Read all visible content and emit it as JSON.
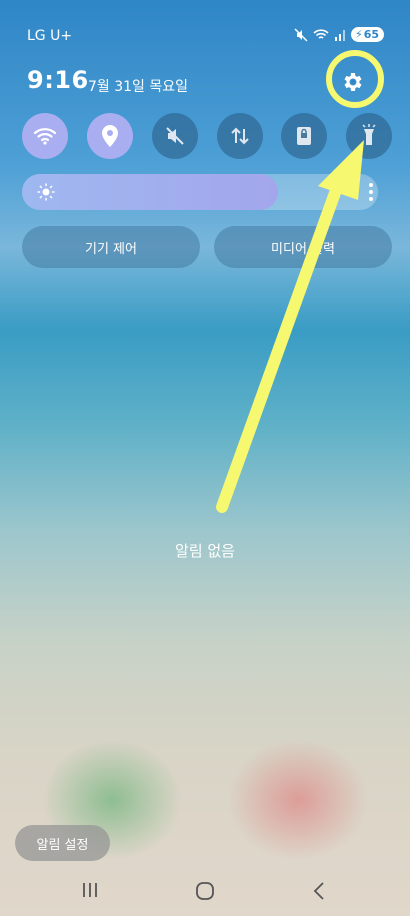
{
  "status": {
    "carrier": "LG U+",
    "battery": "65"
  },
  "header": {
    "time": "9:16",
    "date": "7월 31일 목요일"
  },
  "quick_tiles": [
    {
      "name": "wifi-icon",
      "active": true
    },
    {
      "name": "location-icon",
      "active": true
    },
    {
      "name": "mute-icon",
      "active": false
    },
    {
      "name": "mobile-data-icon",
      "active": false
    },
    {
      "name": "screen-lock-icon",
      "active": false
    },
    {
      "name": "flashlight-icon",
      "active": false
    }
  ],
  "brightness": {
    "level": 0.72
  },
  "controls": {
    "device_control": "기기 제어",
    "media_output": "미디어 출력"
  },
  "notifications": {
    "empty_text": "알림 없음",
    "settings_button": "알림 설정"
  },
  "colors": {
    "accent_tile": "#a9aef0",
    "highlight": "#f6f870"
  }
}
